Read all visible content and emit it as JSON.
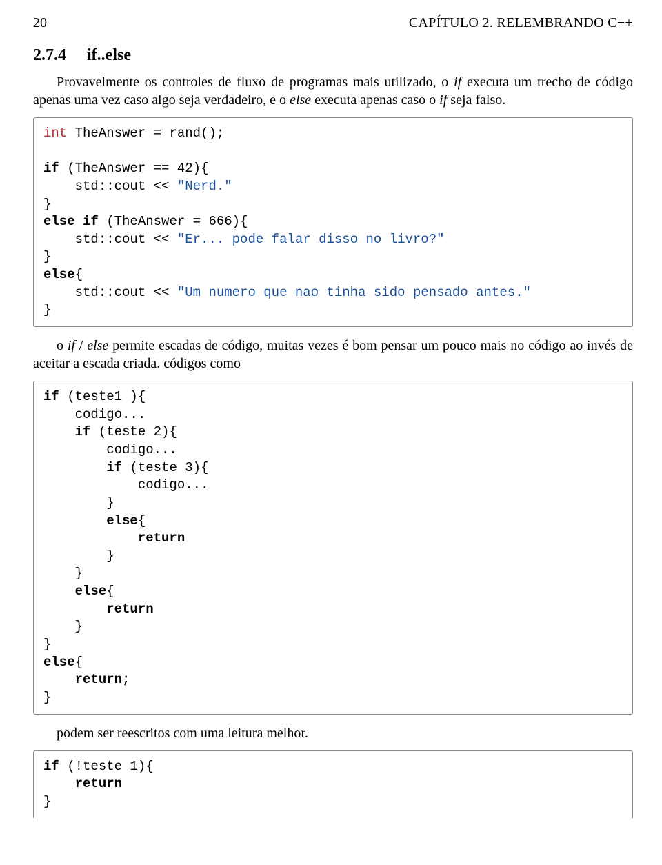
{
  "header": {
    "page_number": "20",
    "chapter_label": "CAPÍTULO 2.",
    "chapter_title": "RELEMBRANDO C++"
  },
  "section": {
    "number": "2.7.4",
    "title": "if..else"
  },
  "para1_a": "Provavelmente os controles de fluxo de programas mais utilizado, o ",
  "para1_if": "if",
  "para1_b": " executa um trecho de código apenas uma vez caso algo seja verdadeiro, e o ",
  "para1_else": "else",
  "para1_c": " executa apenas caso o ",
  "para1_if2": "if",
  "para1_d": " seja falso.",
  "code1": {
    "l1_type": "int",
    "l1_rest": " TheAnswer = rand();",
    "l3_kw": "if",
    "l3_rest": " (TheAnswer == 42){",
    "l4_a": "    std::cout << ",
    "l4_str": "\"Nerd.\"",
    "l5": "}",
    "l6_kw": "else if",
    "l6_rest": " (TheAnswer = 666){",
    "l7_a": "    std::cout << ",
    "l7_str": "\"Er... pode falar disso no livro?\"",
    "l8": "}",
    "l9_kw": "else",
    "l9_rest": "{",
    "l10_a": "    std::cout << ",
    "l10_str": "\"Um numero que nao tinha sido pensado antes.\"",
    "l11": "}"
  },
  "para2_a": "o ",
  "para2_if": "if",
  "para2_sep": " / ",
  "para2_else": "else",
  "para2_b": " permite escadas de código, muitas vezes é bom pensar um pouco mais no código ao invés de aceitar a escada criada. códigos como",
  "code2": {
    "l1_kw": "if",
    "l1_rest": " (teste1 ){",
    "l2": "    codigo...",
    "l3_kw": "    if",
    "l3_rest": " (teste 2){",
    "l4": "        codigo...",
    "l5_kw": "        if",
    "l5_rest": " (teste 3){",
    "l6": "            codigo...",
    "l7": "        }",
    "l8_kw": "        else",
    "l8_rest": "{",
    "l9_kw": "            return",
    "l10": "        }",
    "l11": "    }",
    "l12_kw": "    else",
    "l12_rest": "{",
    "l13_kw": "        return",
    "l14": "    }",
    "l15": "}",
    "l16_kw": "else",
    "l16_rest": "{",
    "l17_kw": "    return",
    "l17_rest": ";",
    "l18": "}"
  },
  "para3": "podem ser reescritos com uma leitura melhor.",
  "code3": {
    "l1_kw": "if",
    "l1_rest": " (!teste 1){",
    "l2_kw": "    return",
    "l3": "}"
  }
}
